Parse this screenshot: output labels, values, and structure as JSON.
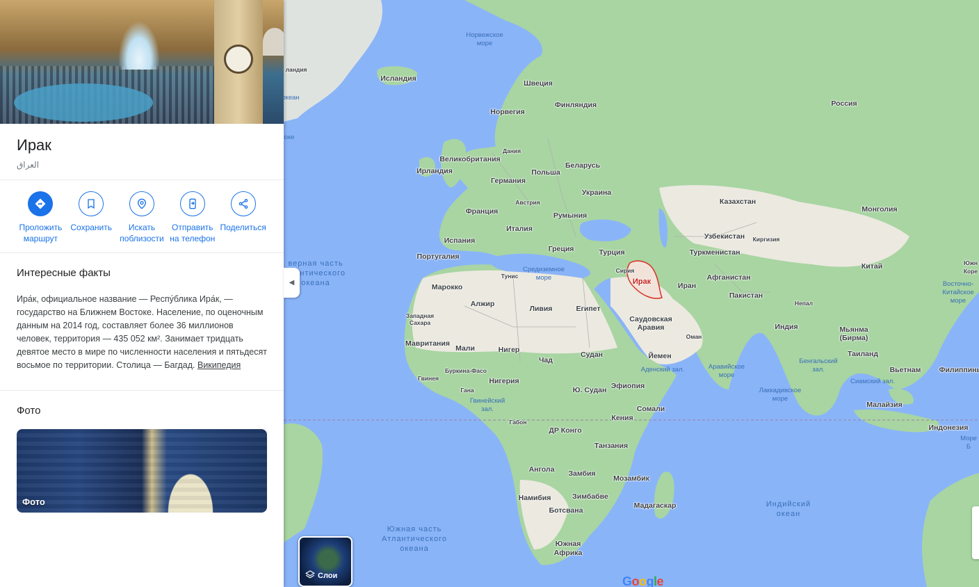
{
  "place": {
    "title": "Ирак",
    "native_name": "العراق"
  },
  "actions": [
    {
      "label": "Проложить\nмаршрут",
      "icon": "directions-icon"
    },
    {
      "label": "Сохранить",
      "icon": "bookmark-icon"
    },
    {
      "label": "Искать\nпоблизости",
      "icon": "nearby-icon"
    },
    {
      "label": "Отправить\nна телефон",
      "icon": "send-to-phone-icon"
    },
    {
      "label": "Поделиться",
      "icon": "share-icon"
    }
  ],
  "facts": {
    "title": "Интересные факты",
    "text": "Ира́к, официальное название — Респу́блика Ира́к, — государство на Ближнем Востоке. Население, по оценочным данным на 2014 год, составляет более 36 миллионов человек, территория — 435 052 км². Занимает тридцать девятое место в мире по численности населения и пятьдесят восьмое по территории. Столица — Багдад.",
    "link": "Википедия"
  },
  "photos": {
    "title": "Фото",
    "card_label": "Фото"
  },
  "map": {
    "selected_label": "Ирак",
    "layers_label": "Слои",
    "google_logo": "Google",
    "countries": [
      {
        "name": "Исландия"
      },
      {
        "name": "Швеция"
      },
      {
        "name": "Финляндия"
      },
      {
        "name": "Норвегия"
      },
      {
        "name": "Россия"
      },
      {
        "name": "Дания"
      },
      {
        "name": "Великобритания"
      },
      {
        "name": "Ирландия"
      },
      {
        "name": "Беларусь"
      },
      {
        "name": "Польша"
      },
      {
        "name": "Германия"
      },
      {
        "name": "Украина"
      },
      {
        "name": "Австрия"
      },
      {
        "name": "Франция"
      },
      {
        "name": "Румыния"
      },
      {
        "name": "Казахстан"
      },
      {
        "name": "Монголия"
      },
      {
        "name": "Италия"
      },
      {
        "name": "Узбекистан"
      },
      {
        "name": "Киргизия"
      },
      {
        "name": "Испания"
      },
      {
        "name": "Греция"
      },
      {
        "name": "Турция"
      },
      {
        "name": "Туркменистан"
      },
      {
        "name": "Португалия"
      },
      {
        "name": "Сирия"
      },
      {
        "name": "Китай"
      },
      {
        "name": "Тунис"
      },
      {
        "name": "Марокко"
      },
      {
        "name": "Иран"
      },
      {
        "name": "Афганистан"
      },
      {
        "name": "Пакистан"
      },
      {
        "name": "Алжир"
      },
      {
        "name": "Ливия"
      },
      {
        "name": "Египет"
      },
      {
        "name": "Непал"
      },
      {
        "name": "Западная\nСахара"
      },
      {
        "name": "Саудовская\nАравия"
      },
      {
        "name": "Индия"
      },
      {
        "name": "Мьянма\n(Бирма)"
      },
      {
        "name": "Оман"
      },
      {
        "name": "Мавритания"
      },
      {
        "name": "Мали"
      },
      {
        "name": "Нигер"
      },
      {
        "name": "Судан"
      },
      {
        "name": "Таиланд"
      },
      {
        "name": "Чад"
      },
      {
        "name": "Йемен"
      },
      {
        "name": "Вьетнам"
      },
      {
        "name": "Филиппины"
      },
      {
        "name": "Буркина-Фасо"
      },
      {
        "name": "Гвинея"
      },
      {
        "name": "Нигерия"
      },
      {
        "name": "Эфиопия"
      },
      {
        "name": "Гана"
      },
      {
        "name": "Ю. Судан"
      },
      {
        "name": "Сомали"
      },
      {
        "name": "Малайзия"
      },
      {
        "name": "Кения"
      },
      {
        "name": "Габон"
      },
      {
        "name": "ДР Конго"
      },
      {
        "name": "Индонезия"
      },
      {
        "name": "Танзания"
      },
      {
        "name": "Ангола"
      },
      {
        "name": "Замбия"
      },
      {
        "name": "Мозамбик"
      },
      {
        "name": "Намибия"
      },
      {
        "name": "Зимбабве"
      },
      {
        "name": "Мадагаскар"
      },
      {
        "name": "Ботсвана"
      },
      {
        "name": "Южная\nАфрика"
      },
      {
        "name": "Южн"
      },
      {
        "name": "Коре"
      },
      {
        "name": "ландия"
      }
    ],
    "waters": [
      {
        "name": "Норвежское\nморе"
      },
      {
        "name": "Средиземное\nморе"
      },
      {
        "name": "Восточно-Китайское\nморе"
      },
      {
        "name": "Аденский зал."
      },
      {
        "name": "Аравийское\nморе"
      },
      {
        "name": "Бенгальский\nзал."
      },
      {
        "name": "Сиамский зал."
      },
      {
        "name": "Лаккадивское\nморе"
      },
      {
        "name": "Гвинейский\nзал."
      },
      {
        "name": "Море Б"
      },
      {
        "name": "океан"
      },
      {
        "name": "оке"
      }
    ],
    "oceans": [
      {
        "name": "верная часть\nтлантического\nокеана"
      },
      {
        "name": "Индийский\nокеан"
      },
      {
        "name": "Южная часть\nАтлантического\nокеана"
      }
    ]
  }
}
